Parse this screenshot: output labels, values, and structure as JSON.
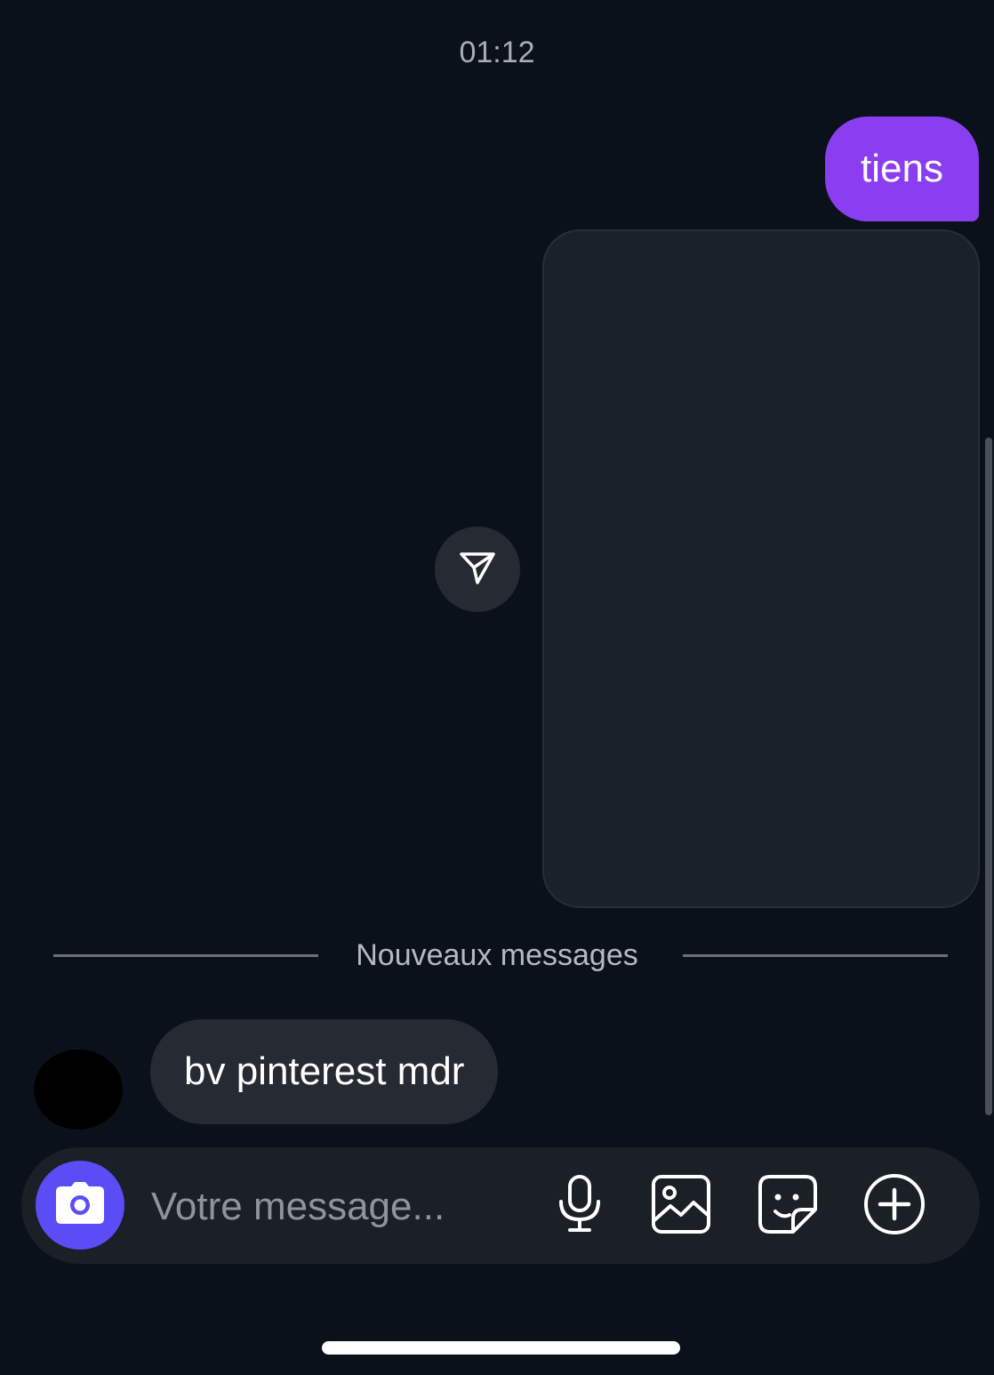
{
  "chat": {
    "timestamp": "01:12",
    "outgoing_text": "tiens",
    "new_messages_label": "Nouveaux messages",
    "incoming_text": "bv pinterest mdr"
  },
  "composer": {
    "placeholder": "Votre message..."
  },
  "icons": {
    "share": "send-icon",
    "camera": "camera-icon",
    "mic": "microphone-icon",
    "gallery": "image-icon",
    "sticker": "sticker-icon",
    "more": "plus-circle-icon"
  },
  "colors": {
    "background": "#0b111a",
    "outgoing_bubble": "#8a3ef0",
    "incoming_bubble": "#262b33",
    "camera_button": "#5b4cf5"
  }
}
